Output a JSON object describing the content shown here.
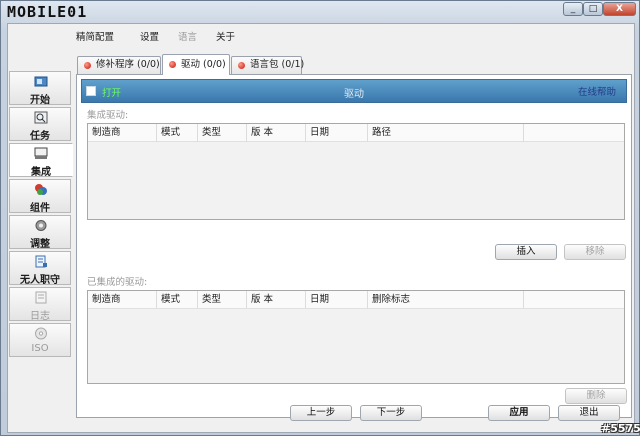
{
  "window": {
    "title": "MOBILE01",
    "buttons": {
      "minimize": "_",
      "maximize": "□",
      "close": "X"
    }
  },
  "menu": [
    "精简配置",
    "设置",
    "语言",
    "关于"
  ],
  "sidebar": {
    "items": [
      {
        "label": "开始",
        "icon": "start-icon"
      },
      {
        "label": "任务",
        "icon": "task-icon"
      },
      {
        "label": "集成",
        "icon": "integrate-icon"
      },
      {
        "label": "组件",
        "icon": "components-icon"
      },
      {
        "label": "调整",
        "icon": "tweak-icon"
      },
      {
        "label": "无人职守",
        "icon": "unattended-icon"
      },
      {
        "label": "日志",
        "icon": "log-icon"
      },
      {
        "label": "ISO",
        "icon": "iso-icon"
      }
    ]
  },
  "tabs": [
    {
      "label": "修补程序 (0/0)"
    },
    {
      "label": "驱动 (0/0)"
    },
    {
      "label": "语言包 (0/1)"
    }
  ],
  "header": {
    "open_label": "打开",
    "title": "驱动",
    "help_link": "在线帮助"
  },
  "integrate_drivers": {
    "label": "集成驱动:",
    "columns": [
      "制造商",
      "模式",
      "类型",
      "版  本",
      "日期",
      "路径"
    ]
  },
  "integrated_drivers": {
    "label": "已集成的驱动:",
    "columns": [
      "制造商",
      "模式",
      "类型",
      "版  本",
      "日期",
      "删除标志"
    ]
  },
  "buttons": {
    "insert": "插入",
    "remove": "移除",
    "delete": "删除",
    "prev": "上一步",
    "next": "下一步",
    "apply": "应用",
    "exit": "退出"
  },
  "watermark": "#5575",
  "colors": {
    "header_blue": "#3a78ad",
    "open_green": "#6dff5a",
    "tab_dot_red": "#c4160c"
  }
}
